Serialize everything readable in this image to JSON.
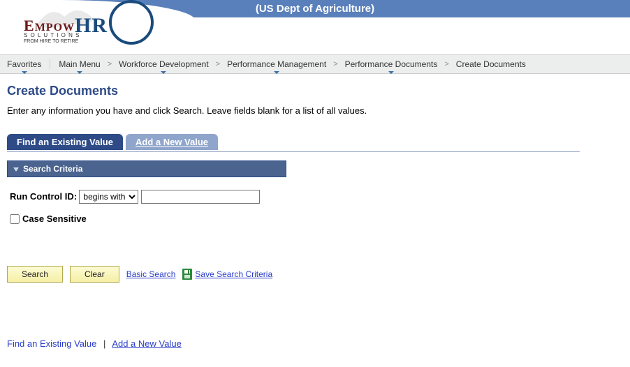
{
  "header": {
    "banner_title": "(US Dept of Agriculture)",
    "logo_main_e": "E",
    "logo_main_mpow": "MPOW",
    "logo_main_hr": "HR",
    "logo_sub1": "S O L U T I O N S",
    "logo_sub2": "FROM HIRE TO RETIRE"
  },
  "breadcrumb": {
    "items": [
      {
        "label": "Favorites",
        "drop": true
      },
      {
        "label": "Main Menu",
        "drop": true
      },
      {
        "label": "Workforce Development",
        "drop": true
      },
      {
        "label": "Performance Management",
        "drop": true
      },
      {
        "label": "Performance Documents",
        "drop": true
      },
      {
        "label": "Create Documents",
        "drop": false
      }
    ]
  },
  "page": {
    "title": "Create Documents",
    "instruction": "Enter any information you have and click Search. Leave fields blank for a list of all values."
  },
  "tabs": {
    "active": "Find an Existing Value",
    "inactive": "Add a New Value"
  },
  "section": {
    "heading": "Search Criteria"
  },
  "fields": {
    "run_control_label": "Run Control ID:",
    "run_control_operator_options": [
      "begins with"
    ],
    "run_control_operator_selected": "begins with",
    "run_control_value": "",
    "case_sensitive_label": "Case Sensitive",
    "case_sensitive_checked": false
  },
  "actions": {
    "search_label": "Search",
    "clear_label": "Clear",
    "basic_search_label": "Basic Search",
    "save_criteria_label": "Save Search Criteria"
  },
  "footer": {
    "link1": "Find an Existing Value",
    "link2": "Add a New Value"
  }
}
